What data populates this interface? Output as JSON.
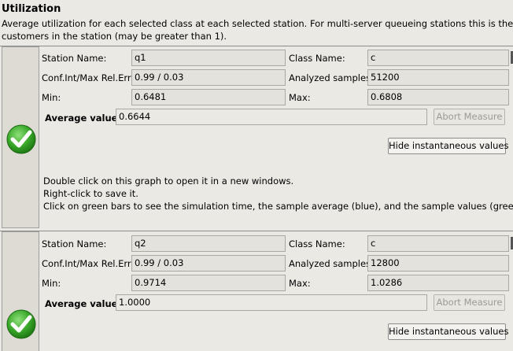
{
  "header": {
    "title": "Utilization",
    "description_line1": "Average utilization for each selected class at each selected station. For multi-server queueing stations this is the average utili",
    "description_line2": "customers in the station (may be greater than 1)."
  },
  "labels": {
    "station_name": "Station Name:",
    "class_name": "Class Name:",
    "conf_int": "Conf.Int/Max Rel.Err:",
    "analyzed_samples": "Analyzed samples:",
    "min": "Min:",
    "max": "Max:",
    "average_value": "Average value:",
    "abort_measure": "Abort Measure",
    "hide_instantaneous": "Hide instantaneous values"
  },
  "measures": [
    {
      "station_name": "q1",
      "class_name": "c",
      "conf_int": "0.99 / 0.03",
      "analyzed_samples": "51200",
      "min": "0.6481",
      "max": "0.6808",
      "average_value": "0.6644",
      "messages": [
        "Double click on this graph to open it in a new windows.",
        "Right-click to save it.",
        "Click on green bars to see the simulation time, the sample average (blue), and the sample values (green)."
      ],
      "status_icon": "green-check-icon"
    },
    {
      "station_name": "q2",
      "class_name": "c",
      "conf_int": "0.99 / 0.03",
      "analyzed_samples": "12800",
      "min": "0.9714",
      "max": "1.0286",
      "average_value": "1.0000",
      "status_icon": "green-check-icon"
    }
  ],
  "colors": {
    "check_green": "#2f9e1e",
    "panel_bg": "#ebe9e4"
  }
}
